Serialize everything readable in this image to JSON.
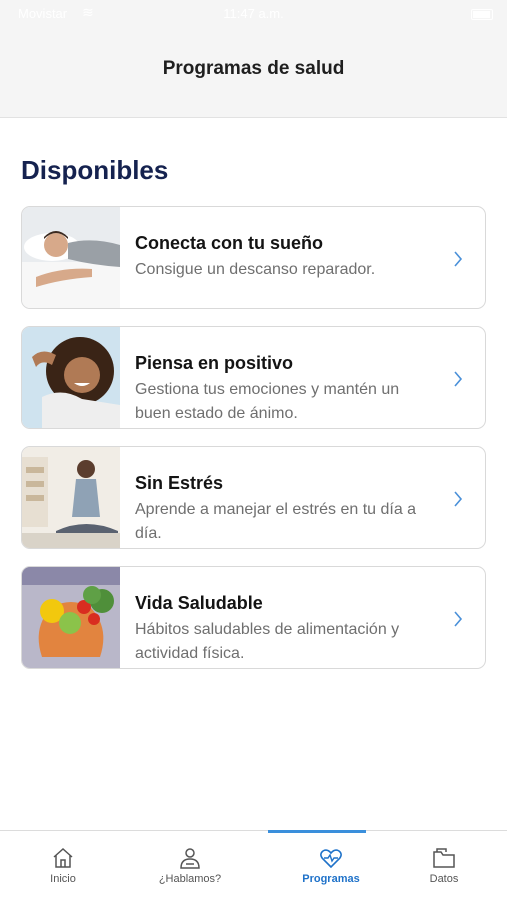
{
  "status_bar": {
    "carrier": "Movistar",
    "time": "11:47 a.m."
  },
  "header": {
    "title": "Programas de salud"
  },
  "section": {
    "title": "Disponibles"
  },
  "programs": [
    {
      "title": "Conecta con tu sueño",
      "description": "Consigue un descanso reparador."
    },
    {
      "title": "Piensa en positivo",
      "description": "Gestiona tus emociones y mantén un buen estado de ánimo."
    },
    {
      "title": "Sin Estrés",
      "description": "Aprende a manejar el estrés en tu día a día."
    },
    {
      "title": "Vida Saludable",
      "description": "Hábitos saludables de alimentación y actividad física."
    }
  ],
  "tabs": [
    {
      "label": "Inicio",
      "icon": "home-icon"
    },
    {
      "label": "¿Hablamos?",
      "icon": "person-chat-icon"
    },
    {
      "label": "Programas",
      "icon": "heart-pulse-icon",
      "active": true
    },
    {
      "label": "Datos",
      "icon": "folder-icon"
    }
  ],
  "colors": {
    "accent": "#1f72c9",
    "section_title": "#15224f",
    "chevron": "#4a90d9"
  }
}
